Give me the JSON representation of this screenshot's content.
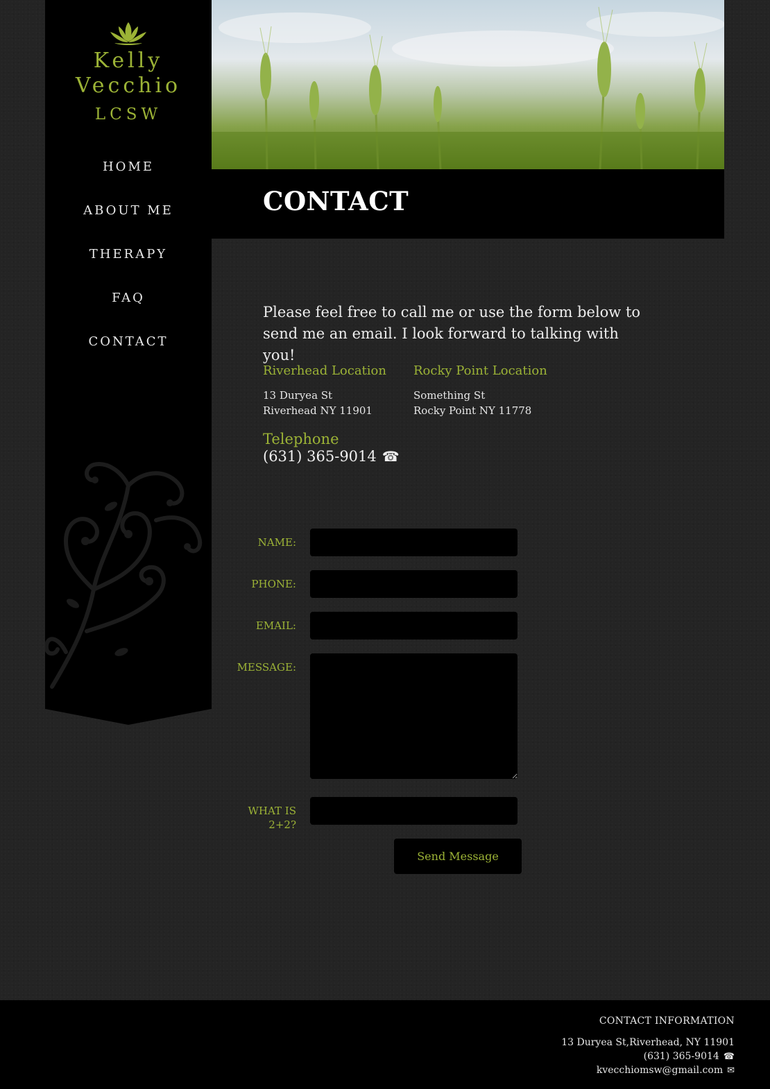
{
  "brand": {
    "name_line1": "Kelly",
    "name_line2": "Vecchio",
    "credential": "LCSW",
    "accent_color": "#9cb336"
  },
  "nav": {
    "items": [
      {
        "label": "HOME"
      },
      {
        "label": "ABOUT ME"
      },
      {
        "label": "THERAPY"
      },
      {
        "label": "FAQ"
      },
      {
        "label": "CONTACT"
      }
    ]
  },
  "page": {
    "title": "CONTACT",
    "intro": "Please feel free to call me or use the form below to send me an email. I look forward to talking with you!"
  },
  "locations": [
    {
      "heading": "Riverhead Location",
      "line1": "13 Duryea St",
      "line2": "Riverhead NY 11901"
    },
    {
      "heading": "Rocky Point Location",
      "line1": "Something St",
      "line2": "Rocky Point NY 11778"
    }
  ],
  "telephone": {
    "heading": "Telephone",
    "number": "(631) 365-9014",
    "icon": "telephone-icon"
  },
  "form": {
    "name_label": "NAME:",
    "phone_label": "PHONE:",
    "email_label": "EMAIL:",
    "message_label": "MESSAGE:",
    "captcha_label_line1": "WHAT IS",
    "captcha_label_line2": "2+2?",
    "name_value": "",
    "phone_value": "",
    "email_value": "",
    "message_value": "",
    "captcha_value": "",
    "send_label": "Send Message"
  },
  "footer": {
    "heading": "CONTACT INFORMATION",
    "address": "13 Duryea St,Riverhead, NY 11901",
    "phone": "(631) 365-9014",
    "email": "kvecchiomsw@gmail.com",
    "phone_icon": "telephone-icon",
    "email_icon": "envelope-icon"
  }
}
